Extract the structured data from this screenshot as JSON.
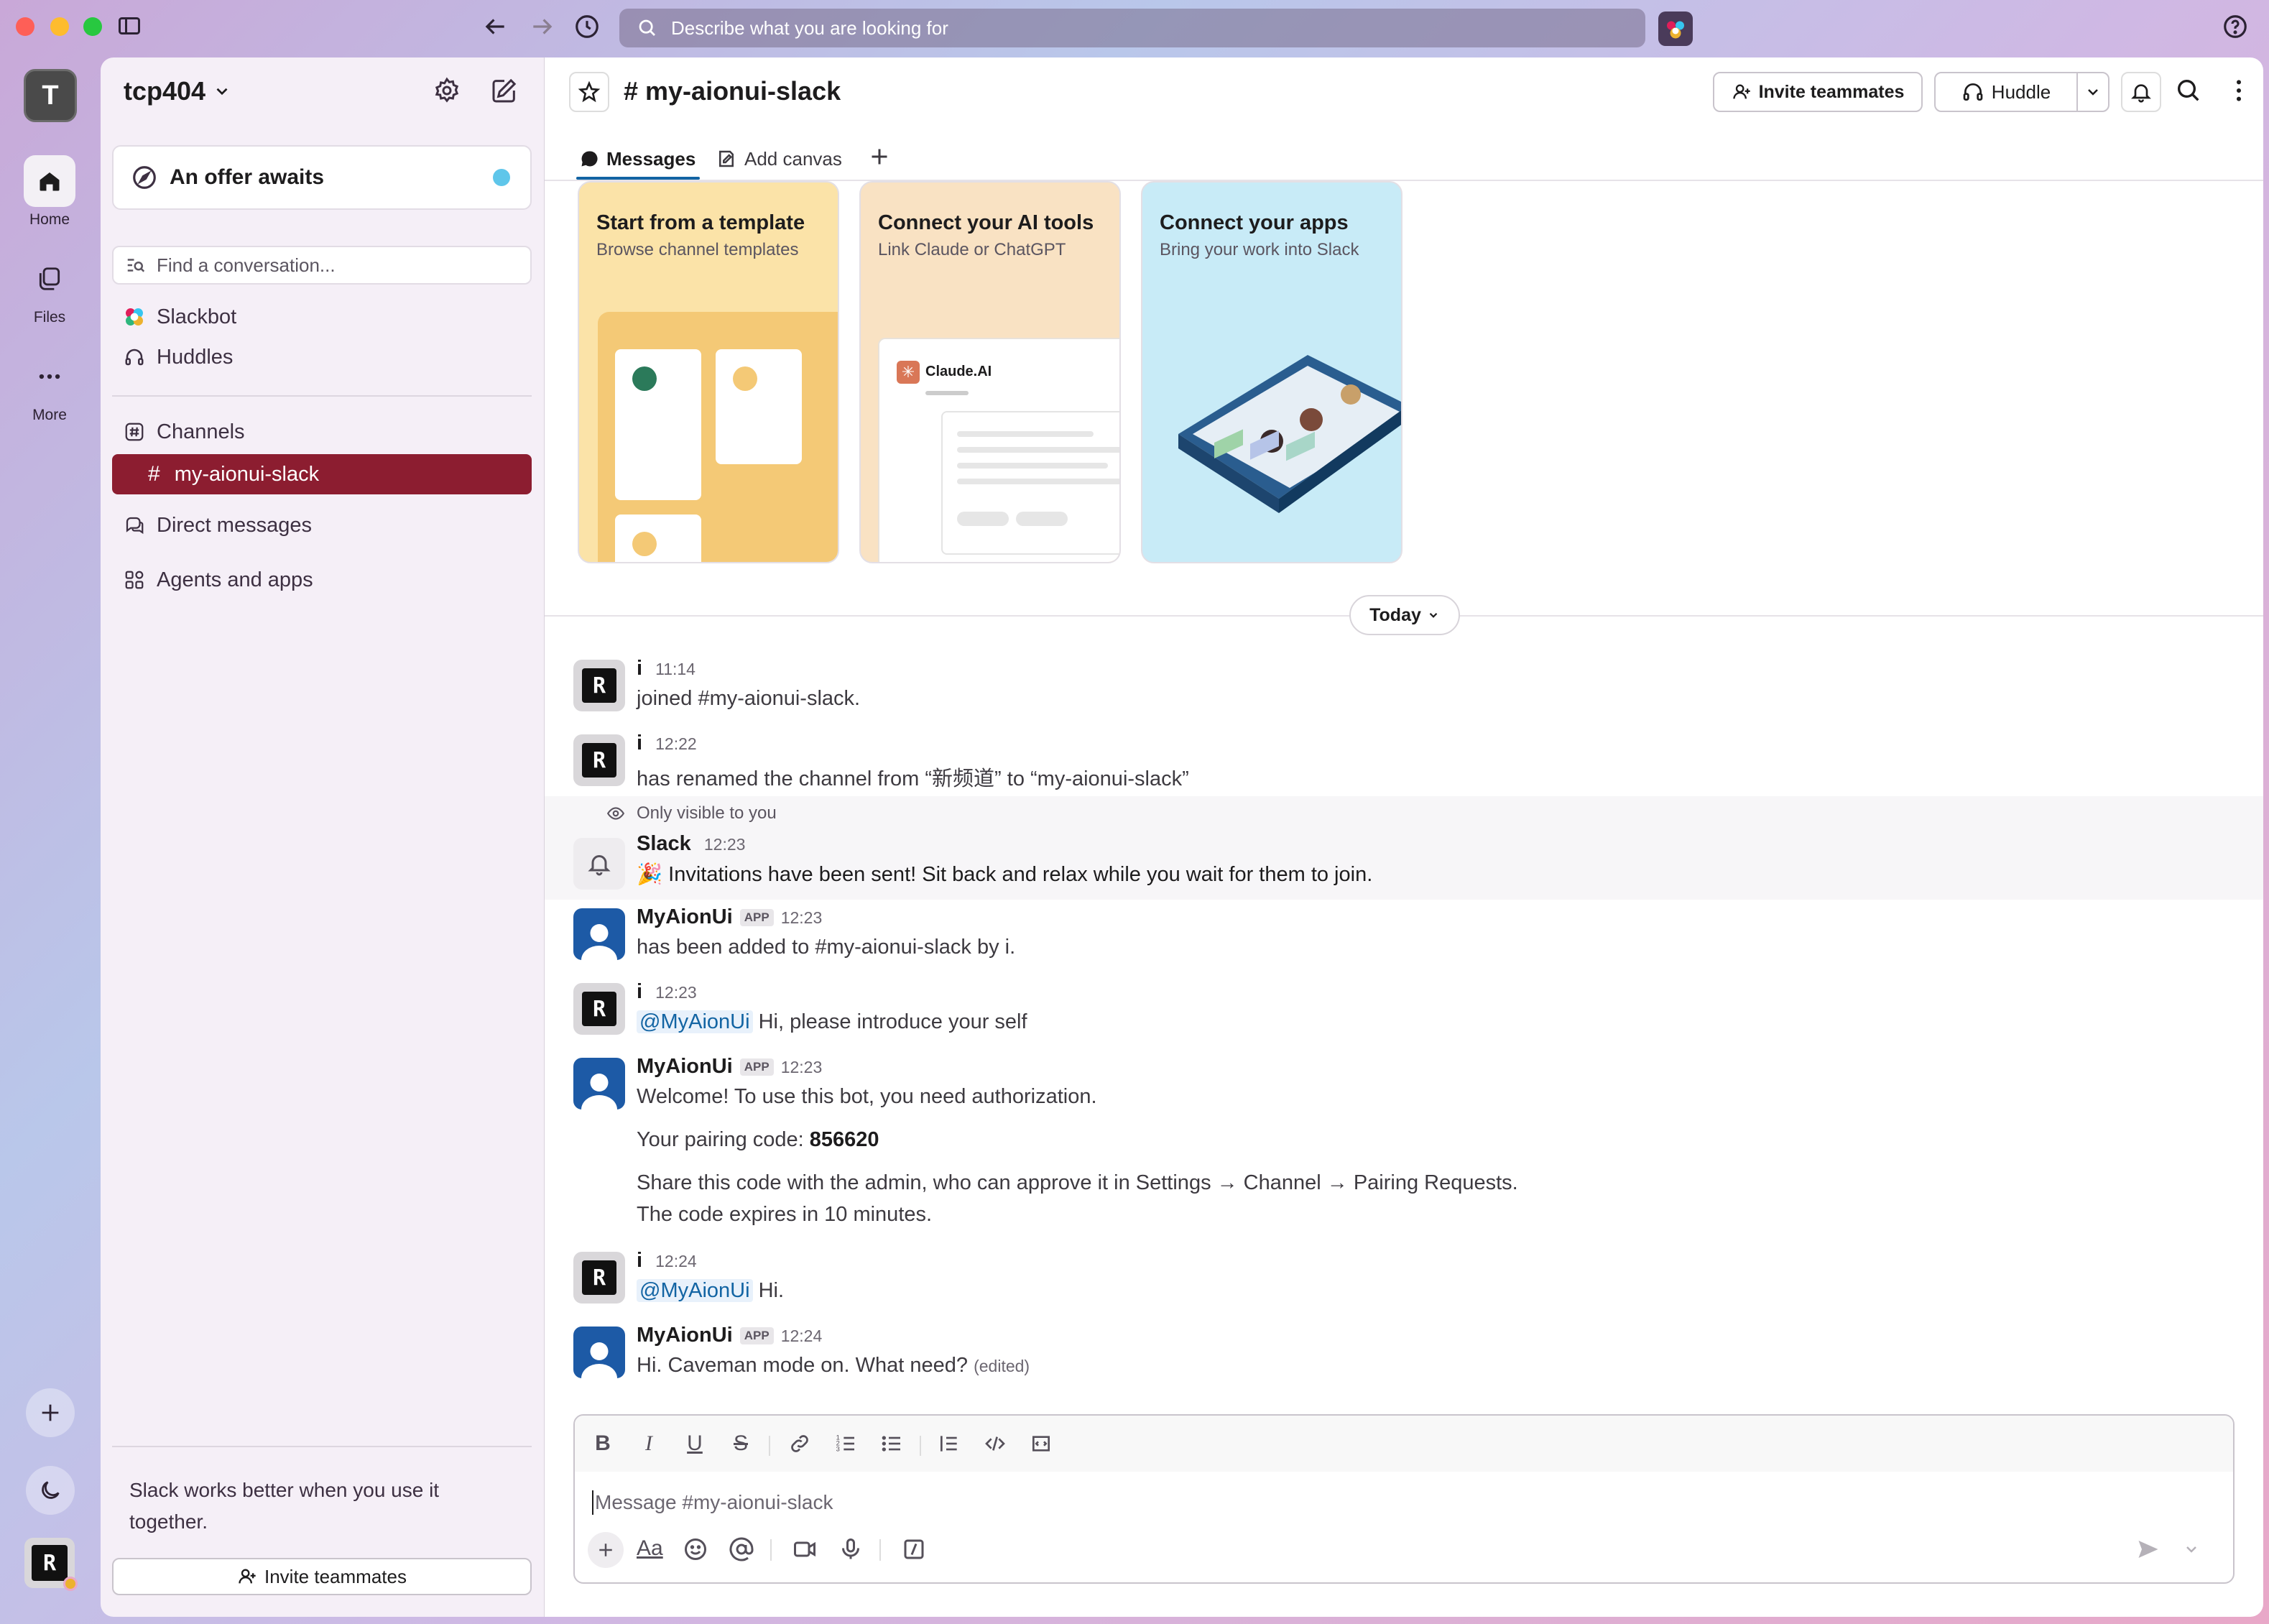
{
  "topbar": {
    "search_placeholder": "Describe what you are looking for"
  },
  "rail": {
    "workspace_initial": "T",
    "home_label": "Home",
    "files_label": "Files",
    "more_label": "More"
  },
  "sidebar": {
    "workspace_name": "tcp404",
    "offer_label": "An offer awaits",
    "find_placeholder": "Find a conversation...",
    "items": [
      {
        "label": "Slackbot"
      },
      {
        "label": "Huddles"
      },
      {
        "label": "Channels"
      },
      {
        "label": "my-aionui-slack"
      },
      {
        "label": "Direct messages"
      },
      {
        "label": "Agents and apps"
      }
    ],
    "footer_text": "Slack works better when you use it together.",
    "footer_line1": "Slack works better when you use it",
    "footer_line2": "together.",
    "invite_label": "Invite teammates"
  },
  "header": {
    "channel_name": "# my-aionui-slack",
    "invite_label": "Invite teammates",
    "huddle_label": "Huddle",
    "tabs": [
      {
        "label": "Messages"
      },
      {
        "label": "Add canvas"
      }
    ]
  },
  "cards": [
    {
      "title": "Start from a template",
      "subtitle": "Browse channel templates"
    },
    {
      "title": "Connect your AI tools",
      "subtitle": "Link Claude or ChatGPT",
      "inner_label": "Claude.AI"
    },
    {
      "title": "Connect your apps",
      "subtitle": "Bring your work into Slack"
    }
  ],
  "divider_label": "Today",
  "messages": [
    {
      "author": "i",
      "time": "11:14",
      "text": "joined #my-aionui-slack."
    },
    {
      "author": "i",
      "time": "12:22",
      "text": "has renamed the channel from “新频道” to “my-aionui-slack”"
    },
    {
      "notice": "Only visible to you",
      "author": "Slack",
      "time": "12:23",
      "text": "🎉 Invitations have been sent! Sit back and relax while you wait for them to join."
    },
    {
      "author": "MyAionUi",
      "tag": "APP",
      "time": "12:23",
      "text": "has been added to #my-aionui-slack by i."
    },
    {
      "author": "i",
      "time": "12:23",
      "mention": "@MyAionUi",
      "text": " Hi, please introduce your self"
    },
    {
      "author": "MyAionUi",
      "tag": "APP",
      "time": "12:23",
      "text": "Welcome! To use this bot, you need authorization.",
      "code_label": "Your pairing code: ",
      "code": "856620",
      "line3": "Share this code with the admin, who can approve it in Settings → Channel → Pairing Requests.",
      "line4": "The code expires in 10 minutes."
    },
    {
      "author": "i",
      "time": "12:24",
      "mention": "@MyAionUi",
      "text": " Hi."
    },
    {
      "author": "MyAionUi",
      "tag": "APP",
      "time": "12:24",
      "text": "Hi. Caveman mode on. What need?",
      "edited": "(edited)"
    }
  ],
  "composer": {
    "placeholder": "Message #my-aionui-slack"
  }
}
